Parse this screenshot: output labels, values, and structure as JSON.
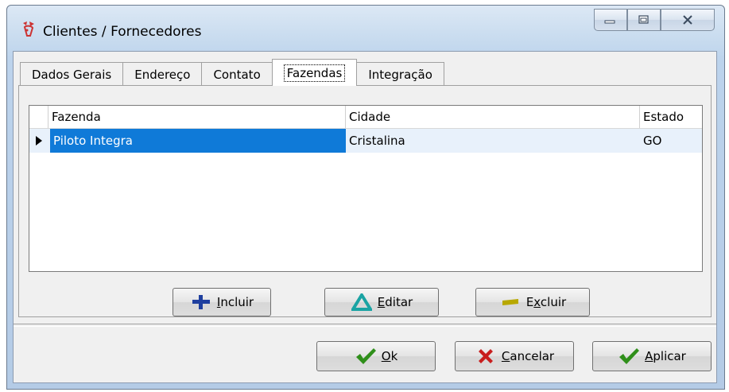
{
  "window": {
    "title": "Clientes / Fornecedores",
    "caption_buttons": [
      "minimize-icon",
      "maximize-icon",
      "close-icon"
    ]
  },
  "tabs": [
    {
      "label": "Dados Gerais",
      "active": false
    },
    {
      "label": "Endereço",
      "active": false
    },
    {
      "label": "Contato",
      "active": false
    },
    {
      "label": "Fazendas",
      "active": true
    },
    {
      "label": "Integração",
      "active": false
    }
  ],
  "grid": {
    "columns": [
      "Fazenda",
      "Cidade",
      "Estado"
    ],
    "rows": [
      {
        "fazenda": "Piloto Integra",
        "cidade": "Cristalina",
        "estado": "GO",
        "selected": true
      }
    ]
  },
  "grid_buttons": {
    "incluir": {
      "underlined": "I",
      "rest": "ncluir",
      "icon": "plus-icon"
    },
    "editar": {
      "underlined": "E",
      "rest": "ditar",
      "icon": "triangle-icon"
    },
    "excluir": {
      "prefix": "E",
      "underlined": "x",
      "rest": "cluir",
      "icon": "minus-icon"
    }
  },
  "dialog_buttons": {
    "ok": {
      "underlined": "O",
      "rest": "k",
      "icon": "check-icon"
    },
    "cancelar": {
      "underlined": "C",
      "rest": "ancelar",
      "icon": "x-icon"
    },
    "aplicar": {
      "underlined": "A",
      "rest": "plicar",
      "icon": "check-icon"
    }
  },
  "colors": {
    "selection": "#0f7ad8",
    "check": "#2f8f1a",
    "cancel": "#c81e1e",
    "plus": "#1f3f9f",
    "triangle": "#1aa3a3",
    "minus": "#b8a800"
  }
}
